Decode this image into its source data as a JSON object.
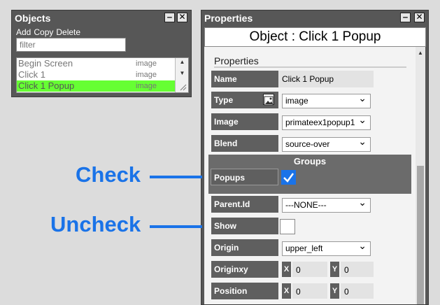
{
  "objects_panel": {
    "title": "Objects",
    "minimize": "‒",
    "close": "✕",
    "menu": [
      "Add",
      "Copy",
      "Delete"
    ],
    "filter_placeholder": "filter",
    "items": [
      {
        "name": "Begin Screen",
        "kind": "image",
        "selected": false
      },
      {
        "name": "Click 1",
        "kind": "image",
        "selected": false
      },
      {
        "name": "Click 1 Popup",
        "kind": "image",
        "selected": true
      }
    ],
    "selected_color": "#66ff33"
  },
  "properties_panel": {
    "title": "Properties",
    "minimize": "‒",
    "close": "✕",
    "header": "Object : Click 1 Popup",
    "section_title": "Properties",
    "fields": {
      "name_label": "Name",
      "name_value": "Click 1 Popup",
      "type_label": "Type",
      "type_value": "image",
      "image_label": "Image",
      "image_value": "primateex1popup1",
      "blend_label": "Blend",
      "blend_value": "source-over",
      "groups_title": "Groups",
      "popups_label": "Popups",
      "popups_checked": true,
      "parentid_label": "Parent.Id",
      "parentid_value": "---NONE---",
      "show_label": "Show",
      "show_checked": false,
      "origin_label": "Origin",
      "origin_value": "upper_left",
      "originxy_label": "Originxy",
      "originxy_x": "0",
      "originxy_y": "0",
      "position_label": "Position",
      "position_x": "0",
      "position_y": "0",
      "x_tag": "X",
      "y_tag": "Y"
    }
  },
  "annotations": {
    "check": "Check",
    "uncheck": "Uncheck",
    "color": "#1a73e8"
  }
}
